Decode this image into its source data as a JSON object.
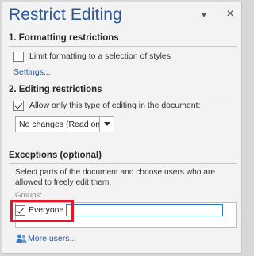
{
  "pane": {
    "title": "Restrict Editing",
    "menu_glyph": "▼",
    "close_glyph": "×"
  },
  "formatting": {
    "heading": "1. Formatting restrictions",
    "checkbox_label": "Limit formatting to a selection of styles",
    "checked": false,
    "settings_link": "Settings..."
  },
  "editing": {
    "heading": "2. Editing restrictions",
    "checkbox_label": "Allow only this type of editing in the document:",
    "checked": true,
    "dropdown_value": "No changes (Read only)"
  },
  "exceptions": {
    "heading": "Exceptions (optional)",
    "description": "Select parts of the document and choose users who are allowed to freely edit them.",
    "groups_label": "Groups:",
    "group_item_label": "Everyone",
    "group_item_checked": true,
    "more_users_link": "More users..."
  },
  "colors": {
    "title_blue": "#2b579a",
    "highlight_red": "#e1182a",
    "field_blue": "#2b79d0"
  }
}
